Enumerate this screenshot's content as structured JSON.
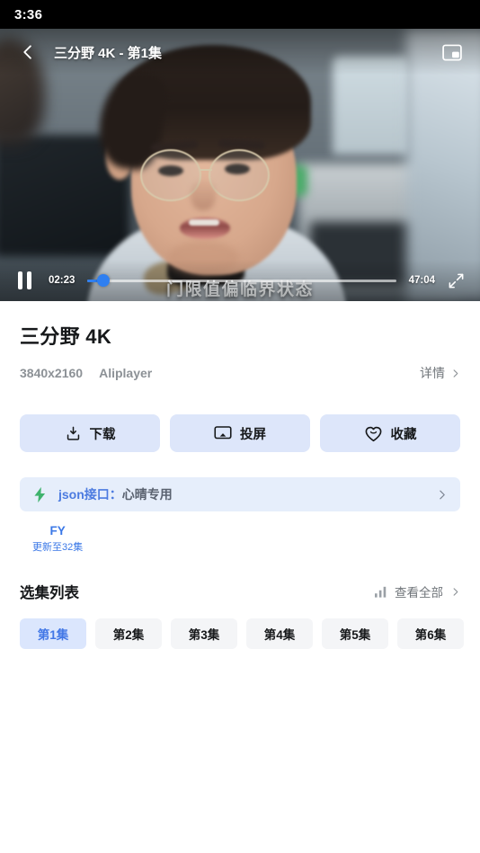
{
  "status_bar": {
    "time": "3:36"
  },
  "player": {
    "back_icon": "chevron-left-icon",
    "title": "三分野 4K - 第1集",
    "pip_icon": "picture-in-picture-icon",
    "subtitle": "门限值偏临界状态",
    "pause_icon": "pause-icon",
    "current_time": "02:23",
    "duration": "47:04",
    "progress_percent": 5,
    "fullscreen_icon": "fullscreen-icon",
    "accent_color": "#2f7ff0"
  },
  "info": {
    "title": "三分野 4K",
    "resolution": "3840x2160",
    "player_name": "Aliplayer",
    "detail_label": "详情",
    "detail_chevron": "chevron-right-icon"
  },
  "actions": [
    {
      "label": "下载",
      "icon": "download-icon"
    },
    {
      "label": "投屏",
      "icon": "cast-icon"
    },
    {
      "label": "收藏",
      "icon": "heart-icon"
    }
  ],
  "json_banner": {
    "icon": "lightning-bolt-icon",
    "prefix": "json接口：",
    "suffix": "心晴专用",
    "chevron": "chevron-right-icon",
    "accent_color": "#4c7be0",
    "background_color": "#e6eefb"
  },
  "sources": [
    {
      "name": "FY",
      "sub": "更新至32集",
      "active": true
    }
  ],
  "episodes_section": {
    "title": "选集列表",
    "view_all_label": "查看全部",
    "view_all_icon": "bar-chart-icon",
    "view_all_chevron": "chevron-right-icon"
  },
  "episodes": [
    {
      "label": "第1集",
      "active": true
    },
    {
      "label": "第2集",
      "active": false
    },
    {
      "label": "第3集",
      "active": false
    },
    {
      "label": "第4集",
      "active": false
    },
    {
      "label": "第5集",
      "active": false
    },
    {
      "label": "第6集",
      "active": false
    }
  ]
}
